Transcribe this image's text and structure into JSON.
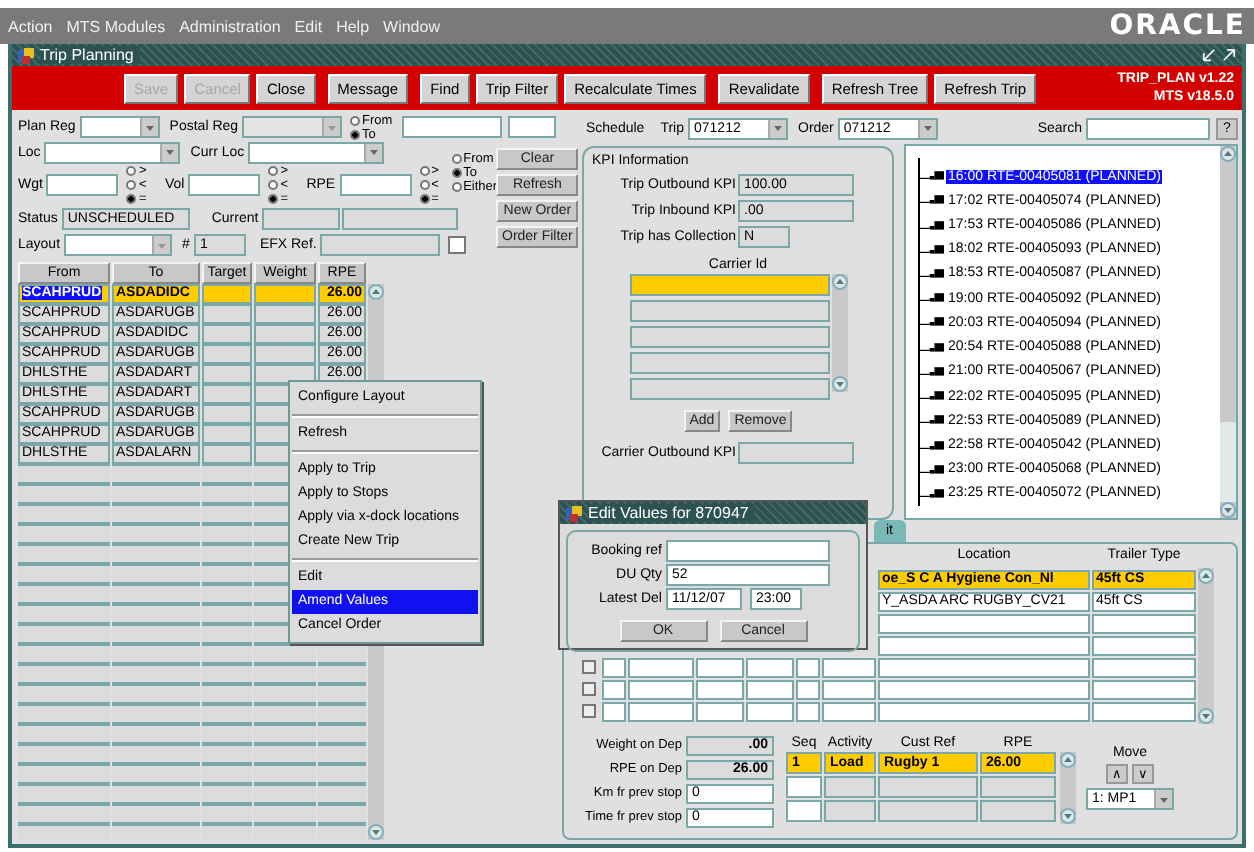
{
  "menu_bar": {
    "items": [
      "Action",
      "MTS Modules",
      "Administration",
      "Edit",
      "Help",
      "Window"
    ],
    "logo": "ORACLE"
  },
  "window": {
    "title": "Trip Planning"
  },
  "toolbar": {
    "groups": [
      [
        {
          "label": "Save",
          "disabled": true
        },
        {
          "label": "Cancel",
          "disabled": true
        },
        {
          "label": "Close",
          "disabled": false
        }
      ],
      [
        {
          "label": "Message",
          "disabled": false
        }
      ],
      [
        {
          "label": "Find",
          "disabled": false
        },
        {
          "label": "Trip Filter",
          "disabled": false
        },
        {
          "label": "Recalculate Times",
          "disabled": false
        }
      ],
      [
        {
          "label": "Revalidate",
          "disabled": false
        }
      ],
      [
        {
          "label": "Refresh Tree",
          "disabled": false
        },
        {
          "label": "Refresh Trip",
          "disabled": false
        }
      ]
    ],
    "version": "TRIP_PLAN v1.22",
    "build": "MTS v18.5.0"
  },
  "filters": {
    "plan_reg": "Plan Reg",
    "postal_reg": "Postal Reg",
    "postal_radio": [
      {
        "label": "From",
        "selected": false
      },
      {
        "label": "To",
        "selected": true
      }
    ],
    "loc": "Loc",
    "curr_loc": "Curr Loc",
    "loc_radio": [
      {
        "label": "From",
        "selected": false
      },
      {
        "label": "To",
        "selected": true
      },
      {
        "label": "Either",
        "selected": false
      }
    ],
    "measures": [
      {
        "label": "Wgt",
        "ops": [
          {
            "label": ">",
            "selected": false
          },
          {
            "label": "<",
            "selected": false
          },
          {
            "label": "=",
            "selected": true
          }
        ]
      },
      {
        "label": "Vol",
        "ops": [
          {
            "label": ">",
            "selected": false
          },
          {
            "label": "<",
            "selected": false
          },
          {
            "label": "=",
            "selected": true
          }
        ]
      },
      {
        "label": "RPE",
        "ops": [
          {
            "label": ">",
            "selected": false
          },
          {
            "label": "<",
            "selected": false
          },
          {
            "label": "=",
            "selected": true
          }
        ]
      }
    ],
    "status": {
      "label": "Status",
      "value": "UNSCHEDULED"
    },
    "current": "Current",
    "layout": "Layout",
    "number": {
      "label": "#",
      "value": "1"
    },
    "efx": {
      "label": "EFX Ref.",
      "checked": false
    },
    "buttons": [
      "Clear",
      "Refresh",
      "New Order",
      "Order Filter"
    ]
  },
  "orders": {
    "columns": [
      "From",
      "To",
      "Target",
      "Weight",
      "RPE"
    ],
    "rows": [
      {
        "from": "SCAHPRUD",
        "to": "ASDADIDC",
        "rpe": "26.00",
        "selected": true
      },
      {
        "from": "SCAHPRUD",
        "to": "ASDARUGB",
        "rpe": "26.00",
        "selected": false
      },
      {
        "from": "SCAHPRUD",
        "to": "ASDADIDC",
        "rpe": "26.00",
        "selected": false
      },
      {
        "from": "SCAHPRUD",
        "to": "ASDARUGB",
        "rpe": "26.00",
        "selected": false
      },
      {
        "from": "DHLSTHE",
        "to": "ASDADART",
        "rpe": "26.00",
        "selected": false
      },
      {
        "from": "DHLSTHE",
        "to": "ASDADART",
        "selected": false
      },
      {
        "from": "SCAHPRUD",
        "to": "ASDARUGB",
        "selected": false
      },
      {
        "from": "SCAHPRUD",
        "to": "ASDARUGB",
        "selected": false
      },
      {
        "from": "DHLSTHE",
        "to": "ASDALARN",
        "selected": false
      }
    ]
  },
  "schedule": {
    "label": "Schedule",
    "trip": {
      "label": "Trip",
      "value": "071212"
    },
    "order": {
      "label": "Order",
      "value": "071212"
    },
    "search": "Search",
    "help": "?"
  },
  "kpi": {
    "title": "KPI Information",
    "rows": [
      {
        "label": "Trip Outbound KPI",
        "value": "100.00"
      },
      {
        "label": "Trip Inbound KPI",
        "value": ".00"
      },
      {
        "label": "Trip has Collection",
        "value": "N"
      }
    ],
    "carrier_header": "Carrier Id",
    "carriers": [
      {
        "selected": true
      },
      {
        "selected": false
      },
      {
        "selected": false
      },
      {
        "selected": false
      },
      {
        "selected": false
      }
    ],
    "buttons": [
      "Add",
      "Remove"
    ],
    "carrier_kpi": "Carrier Outbound KPI"
  },
  "tree": [
    {
      "label": "16:00 RTE-00405081 (PLANNED)",
      "selected": true
    },
    {
      "label": "17:02 RTE-00405074 (PLANNED)",
      "selected": false
    },
    {
      "label": "17:53 RTE-00405086 (PLANNED)",
      "selected": false
    },
    {
      "label": "18:02 RTE-00405093 (PLANNED)",
      "selected": false
    },
    {
      "label": "18:53 RTE-00405087 (PLANNED)",
      "selected": false
    },
    {
      "label": "19:00 RTE-00405092 (PLANNED)",
      "selected": false
    },
    {
      "label": "20:03 RTE-00405094 (PLANNED)",
      "selected": false
    },
    {
      "label": "20:54 RTE-00405088 (PLANNED)",
      "selected": false
    },
    {
      "label": "21:00 RTE-00405067 (PLANNED)",
      "selected": false
    },
    {
      "label": "22:02 RTE-00405095 (PLANNED)",
      "selected": false
    },
    {
      "label": "22:53 RTE-00405089 (PLANNED)",
      "selected": false
    },
    {
      "label": "22:58 RTE-00405042 (PLANNED)",
      "selected": false
    },
    {
      "label": "23:00 RTE-00405068 (PLANNED)",
      "selected": false
    },
    {
      "label": "23:25 RTE-00405072 (PLANNED)",
      "selected": false
    }
  ],
  "stops_tab": {
    "label": "it",
    "selected": true
  },
  "locations": {
    "columns": [
      "Location",
      "Trailer Type"
    ],
    "rows": [
      {
        "location": "oe_S C A Hygiene Con_Nl",
        "trailer_type": "45ft CS",
        "selected": true
      },
      {
        "location": "Y_ASDA ARC RUGBY_CV21",
        "trailer_type": "45ft CS",
        "selected": false
      },
      {
        "selected": false
      },
      {
        "selected": false
      },
      {
        "checked": false,
        "selected": false
      },
      {
        "checked": false,
        "selected": false
      },
      {
        "checked": false,
        "selected": false
      }
    ]
  },
  "stop_summary": [
    {
      "label": "Weight on Dep",
      "value": ".00",
      "kind": "readonly"
    },
    {
      "label": "RPE on Dep",
      "value": "26.00",
      "kind": "readonly"
    },
    {
      "label": "Km fr prev stop",
      "value": "0",
      "kind": "input"
    },
    {
      "label": "Time fr prev stop",
      "value": "0",
      "kind": "input"
    }
  ],
  "stops": {
    "columns": [
      "Seq",
      "Activity",
      "Cust Ref",
      "RPE"
    ],
    "rows": [
      {
        "seq": "1",
        "activity": "Load",
        "cust_ref": "Rugby 1",
        "rpe": "26.00",
        "selected": true
      },
      {
        "selected": false
      },
      {
        "selected": false
      }
    ]
  },
  "move": {
    "label": "Move",
    "buttons": [
      "∧",
      "∨"
    ],
    "value": "1: MP1"
  },
  "context_menu": [
    [
      {
        "label": "Configure Layout",
        "selected": false
      }
    ],
    [
      {
        "label": "Refresh",
        "selected": false
      }
    ],
    [
      {
        "label": "Apply to Trip",
        "selected": false
      },
      {
        "label": "Apply to Stops",
        "selected": false
      },
      {
        "label": "Apply via x-dock locations",
        "selected": false
      },
      {
        "label": "Create New Trip",
        "selected": false
      }
    ],
    [
      {
        "label": "Edit",
        "selected": false
      },
      {
        "label": "Amend Values",
        "selected": true
      },
      {
        "label": "Cancel Order",
        "selected": false
      }
    ]
  ],
  "dialog": {
    "title": "Edit Values for 870947",
    "fields": [
      {
        "label": "Booking ref"
      },
      {
        "label": "DU Qty",
        "value": "52"
      },
      {
        "label": "Latest Del",
        "value": "11/12/07",
        "time": "23:00"
      }
    ],
    "buttons": [
      "OK",
      "Cancel"
    ]
  }
}
